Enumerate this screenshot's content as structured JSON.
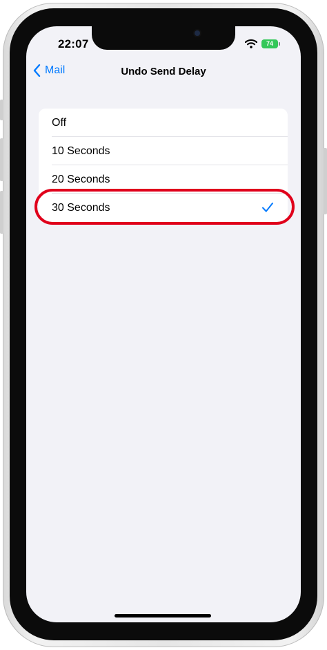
{
  "status_bar": {
    "time": "22:07",
    "battery_level": "74",
    "battery_color": "#34c759"
  },
  "nav": {
    "back_label": "Mail",
    "title": "Undo Send Delay",
    "accent_color": "#007aff"
  },
  "options": [
    {
      "label": "Off",
      "selected": false
    },
    {
      "label": "10 Seconds",
      "selected": false
    },
    {
      "label": "20 Seconds",
      "selected": false
    },
    {
      "label": "30 Seconds",
      "selected": true
    }
  ],
  "annotation": {
    "highlight_color": "#e0001b",
    "highlighted_option": "30 Seconds"
  },
  "icons": [
    "wifi-icon",
    "battery-icon",
    "chevron-left-icon",
    "checkmark-icon"
  ]
}
